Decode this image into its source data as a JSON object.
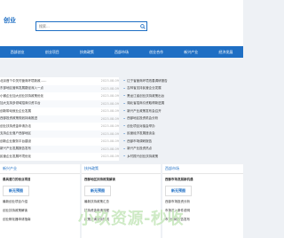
{
  "header": {
    "logo_text": "创业",
    "search_placeholder": "搜索..."
  },
  "nav": {
    "items": [
      "西部创业",
      "创业项目",
      "扶商政策",
      "西部市场",
      "创业合作",
      "新兴产业",
      "经济发展"
    ]
  },
  "list_left": [
    {
      "title": "北京首个中关村营商环境新政……",
      "date": "2023-08-09"
    },
    {
      "title": "东部地区营商发展路径深入一点",
      "date": "2023-08-09"
    },
    {
      "title": "小微企业加大创业扶持政策优化",
      "date": "2023-08-09"
    },
    {
      "title": "加大支持多领域招商引资平台",
      "date": "2023-08-09"
    },
    {
      "title": "创新带动就业企业发展",
      "date": "2023-08-09"
    },
    {
      "title": "西部投资政策规划持续推进",
      "date": "2023-08-09"
    },
    {
      "title": "创业扶持资金申请办法",
      "date": "2023-08-09"
    },
    {
      "title": "支持企业落户西部地区",
      "date": "2023-08-09"
    },
    {
      "title": "创新企业服务平台建设",
      "date": "2023-08-09"
    },
    {
      "title": "新兴产业发展报告发布",
      "date": "2023-08-09"
    },
    {
      "title": "民营企业发展环境优化",
      "date": "2023-08-09"
    }
  ],
  "list_right": [
    "辽宁省营商环境改善调研报告",
    "吉林省支持民营企业发展",
    "黑龙江省创业扶持政策出台",
    "湖北省招商引资取得新进展",
    "新兴产业政策发布会召开",
    "西部地区投资机会分析",
    "创业项目对接会举办",
    "民营经济发展座谈会",
    "西部市场调研报告",
    "新兴产业投资热点",
    "乡村振兴创业扶持政策"
  ],
  "sections": [
    {
      "title": "新兴产业",
      "headline": "最具潜力的创业项目",
      "thumb": "新无预图",
      "small": [
        "最新创业项目介绍",
        "创业扶持政策解读",
        "创业孵化器申请指南"
      ]
    },
    {
      "title": "扶持政策",
      "headline": "西部地区扶持政策解读",
      "thumb": "新无预图",
      "small": [
        "最新扶持政策汇总",
        "扶持资金申请流程",
        "政策咨询服务热线"
      ]
    },
    {
      "title": "西部市场",
      "headline": "西部市场发展新机遇",
      "thumb": "新无预图",
      "small": [
        "西部市场投资分析",
        "市场准入条件说明",
        "市场调研报告发布"
      ]
    }
  ],
  "watermark": "小玖资源-秒收"
}
